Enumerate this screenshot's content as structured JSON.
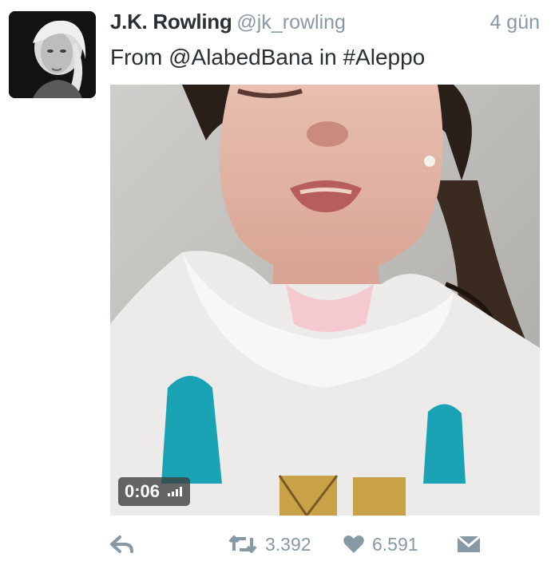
{
  "tweet": {
    "author_name": "J.K. Rowling",
    "author_handle": "@jk_rowling",
    "time": "4 gün",
    "text_prefix": "From ",
    "mention": "@AlabedBana",
    "text_middle": " in ",
    "hashtag": "#Aleppo"
  },
  "media": {
    "type": "video",
    "duration": "0:06"
  },
  "actions": {
    "reply_icon": "reply-icon",
    "retweet_icon": "retweet-icon",
    "retweet_count": "3.392",
    "like_icon": "heart-icon",
    "like_count": "6.591",
    "dm_icon": "envelope-icon"
  },
  "colors": {
    "text": "#292f33",
    "muted": "#8899a6"
  }
}
